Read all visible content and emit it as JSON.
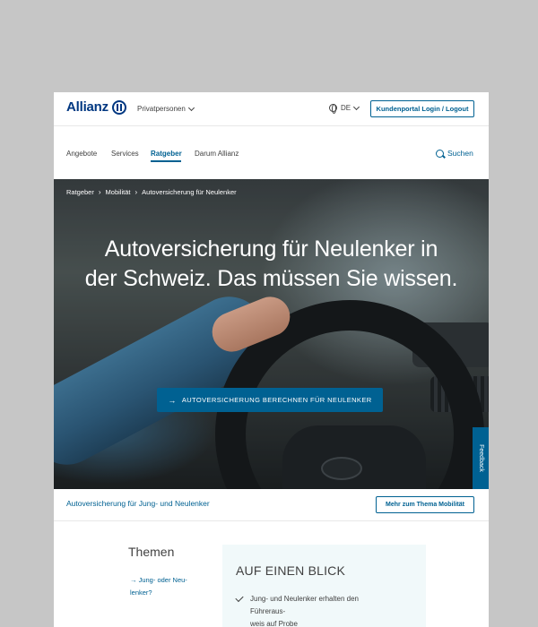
{
  "header": {
    "brand": "Allianz",
    "segment": "Privatpersonen",
    "language": "DE",
    "portal_button": "Kundenportal Login / Logout"
  },
  "nav": {
    "items": [
      {
        "label": "Angebote"
      },
      {
        "label": "Services"
      },
      {
        "label": "Ratgeber",
        "active": true
      },
      {
        "label": "Darum Allianz"
      }
    ],
    "search_label": "Suchen"
  },
  "hero": {
    "breadcrumb": [
      "Ratgeber",
      "Mobilität",
      "Autoversicherung für Neulenker"
    ],
    "title_line1": "Autoversicherung für Neulenker in",
    "title_line2": "der Schweiz. Das müssen Sie wissen.",
    "cta_label": "AUTOVERSICHERUNG BERECHNEN FÜR NEULENKER",
    "feedback_label": "Feedback"
  },
  "subbar": {
    "title": "Autoversicherung für Jung- und Neulenker",
    "button": "Mehr zum Thema Mobilität"
  },
  "themen": {
    "title": "Themen",
    "link_line1": "Jung- oder Neu-",
    "link_line2": "lenker?"
  },
  "glance": {
    "title": "AUF EINEN BLICK",
    "item_line1": "Jung- und Neulenker erhalten den Führeraus-",
    "item_line2": "weis auf Probe"
  },
  "colors": {
    "brand_blue": "#003781",
    "accent_blue": "#006192",
    "glance_bg": "#f1f9fa",
    "backdrop": "#c6c6c6"
  },
  "icons": [
    "allianz-logo-icon",
    "chevron-down-icon",
    "globe-icon",
    "search-icon",
    "arrow-right-icon",
    "chevron-right-icon",
    "check-icon"
  ]
}
